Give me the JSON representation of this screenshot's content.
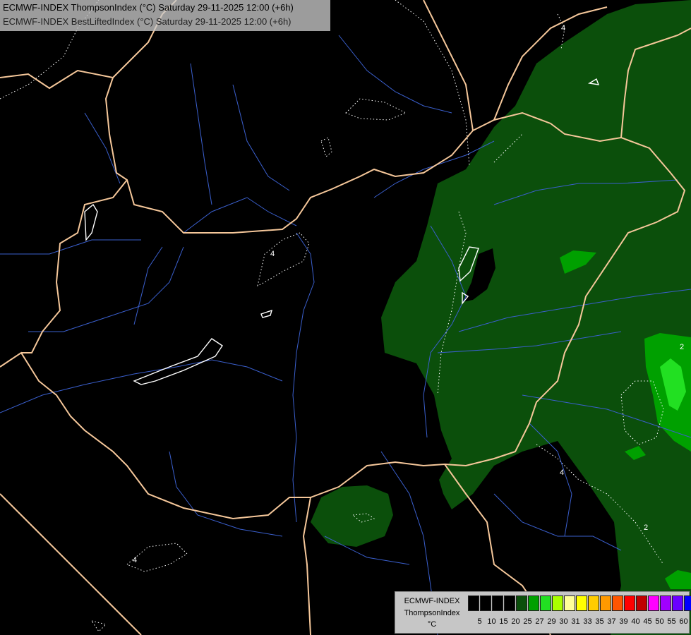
{
  "title": {
    "line1": "ECMWF-INDEX ThompsonIndex (°C) Saturday 29-11-2025 12:00 (+6h)",
    "line2": "ECMWF-INDEX BestLiftedIndex (°C) Saturday 29-11-2025 12:00 (+6h)"
  },
  "legend": {
    "model": "ECMWF-INDEX",
    "parameter": "ThompsonIndex",
    "unit": "°C",
    "ticks": [
      "5",
      "10",
      "15",
      "20",
      "25",
      "27",
      "29",
      "30",
      "31",
      "33",
      "35",
      "37",
      "39",
      "40",
      "45",
      "50",
      "55",
      "60"
    ],
    "colors": [
      "#000000",
      "#000000",
      "#000000",
      "#000000",
      "#0b4f0b",
      "#00a000",
      "#22e022",
      "#aaff00",
      "#ffff99",
      "#ffff00",
      "#ffcc00",
      "#ff9900",
      "#ff5500",
      "#ff0000",
      "#c00000",
      "#ff00ff",
      "#a000ff",
      "#6a00ff",
      "#0000ff"
    ]
  },
  "contour_labels": [
    "4",
    "4",
    "4",
    "2",
    "2",
    "4"
  ],
  "colors": {
    "background": "#000000",
    "index_dark_green": "#0b4f0b",
    "index_mid_green": "#00a000",
    "index_bright_green": "#22e022",
    "borders": "#f5c79a",
    "rivers": "#3a5fcd",
    "lakes": "#ffffff"
  }
}
